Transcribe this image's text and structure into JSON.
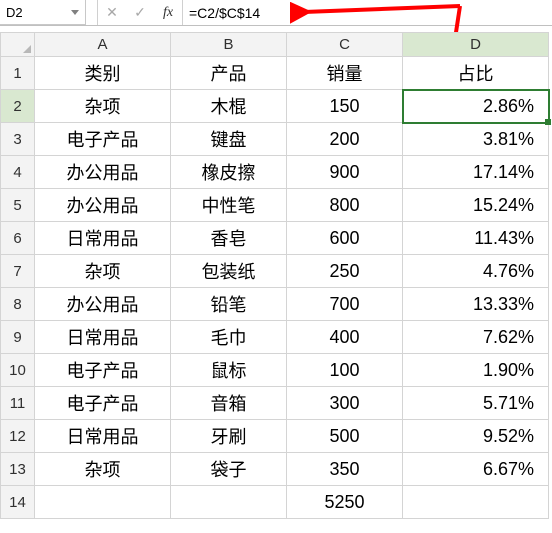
{
  "name_box": "D2",
  "formula": "=C2/$C$14",
  "fbar": {
    "cancel": "✕",
    "confirm": "✓",
    "fx": "fx"
  },
  "columns": [
    "A",
    "B",
    "C",
    "D"
  ],
  "headers": {
    "A": "类别",
    "B": "产品",
    "C": "销量",
    "D": "占比"
  },
  "rows": [
    {
      "no": 2,
      "A": "杂项",
      "B": "木棍",
      "C": "150",
      "D": "2.86%"
    },
    {
      "no": 3,
      "A": "电子产品",
      "B": "键盘",
      "C": "200",
      "D": "3.81%"
    },
    {
      "no": 4,
      "A": "办公用品",
      "B": "橡皮擦",
      "C": "900",
      "D": "17.14%"
    },
    {
      "no": 5,
      "A": "办公用品",
      "B": "中性笔",
      "C": "800",
      "D": "15.24%"
    },
    {
      "no": 6,
      "A": "日常用品",
      "B": "香皂",
      "C": "600",
      "D": "11.43%"
    },
    {
      "no": 7,
      "A": "杂项",
      "B": "包装纸",
      "C": "250",
      "D": "4.76%"
    },
    {
      "no": 8,
      "A": "办公用品",
      "B": "铅笔",
      "C": "700",
      "D": "13.33%"
    },
    {
      "no": 9,
      "A": "日常用品",
      "B": "毛巾",
      "C": "400",
      "D": "7.62%"
    },
    {
      "no": 10,
      "A": "电子产品",
      "B": "鼠标",
      "C": "100",
      "D": "1.90%"
    },
    {
      "no": 11,
      "A": "电子产品",
      "B": "音箱",
      "C": "300",
      "D": "5.71%"
    },
    {
      "no": 12,
      "A": "日常用品",
      "B": "牙刷",
      "C": "500",
      "D": "9.52%"
    },
    {
      "no": 13,
      "A": "杂项",
      "B": "袋子",
      "C": "350",
      "D": "6.67%"
    }
  ],
  "totals_row": {
    "no": 14,
    "C": "5250"
  },
  "active_cell": "D2",
  "chart_data": {
    "type": "table",
    "columns": [
      "类别",
      "产品",
      "销量",
      "占比"
    ],
    "rows": [
      [
        "杂项",
        "木棍",
        150,
        0.0286
      ],
      [
        "电子产品",
        "键盘",
        200,
        0.0381
      ],
      [
        "办公用品",
        "橡皮擦",
        900,
        0.1714
      ],
      [
        "办公用品",
        "中性笔",
        800,
        0.1524
      ],
      [
        "日常用品",
        "香皂",
        600,
        0.1143
      ],
      [
        "杂项",
        "包装纸",
        250,
        0.0476
      ],
      [
        "办公用品",
        "铅笔",
        700,
        0.1333
      ],
      [
        "日常用品",
        "毛巾",
        400,
        0.0762
      ],
      [
        "电子产品",
        "鼠标",
        100,
        0.019
      ],
      [
        "电子产品",
        "音箱",
        300,
        0.0571
      ],
      [
        "日常用品",
        "牙刷",
        500,
        0.0952
      ],
      [
        "杂项",
        "袋子",
        350,
        0.0667
      ]
    ],
    "total_sales": 5250
  }
}
